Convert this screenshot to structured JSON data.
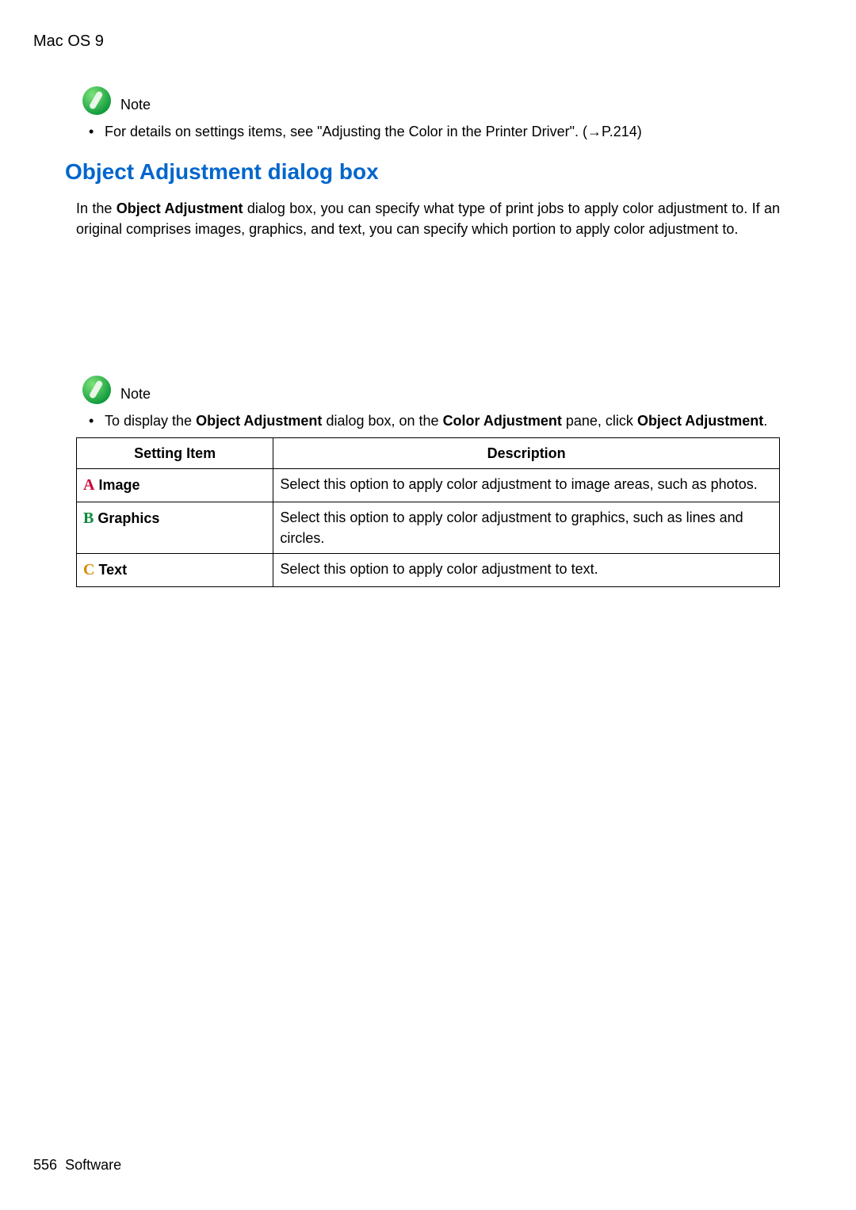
{
  "header": "Mac OS 9",
  "note1": {
    "label": "Note",
    "bullet_prefix": "For details on settings items, see \"Adjusting the Color in the Printer Driver\". (",
    "bullet_link": "→P.214",
    "bullet_suffix": ")"
  },
  "section_title": "Object Adjustment dialog box",
  "paragraph": {
    "p1a": "In the ",
    "p1b": "Object Adjustment",
    "p1c": " dialog box, you can specify what type of print jobs to apply color adjustment to. If an original comprises images, graphics, and text, you can specify which portion to apply color adjustment to."
  },
  "note2": {
    "label": "Note",
    "t1": "To display the ",
    "b1": "Object Adjustment",
    "t2": " dialog box, on the ",
    "b2": "Color Adjustment",
    "t3": " pane, click ",
    "b3": "Object Adjustment",
    "t4": "."
  },
  "table": {
    "head_col1": "Setting Item",
    "head_col2": "Description",
    "rows": [
      {
        "letter": "A",
        "name": "Image",
        "desc": "Select this option to apply color adjustment to image areas, such as photos."
      },
      {
        "letter": "B",
        "name": "Graphics",
        "desc": "Select this option to apply color adjustment to graphics, such as lines and circles."
      },
      {
        "letter": "C",
        "name": "Text",
        "desc": "Select this option to apply color adjustment to text."
      }
    ]
  },
  "footer": {
    "page": "556",
    "section": "Software"
  }
}
